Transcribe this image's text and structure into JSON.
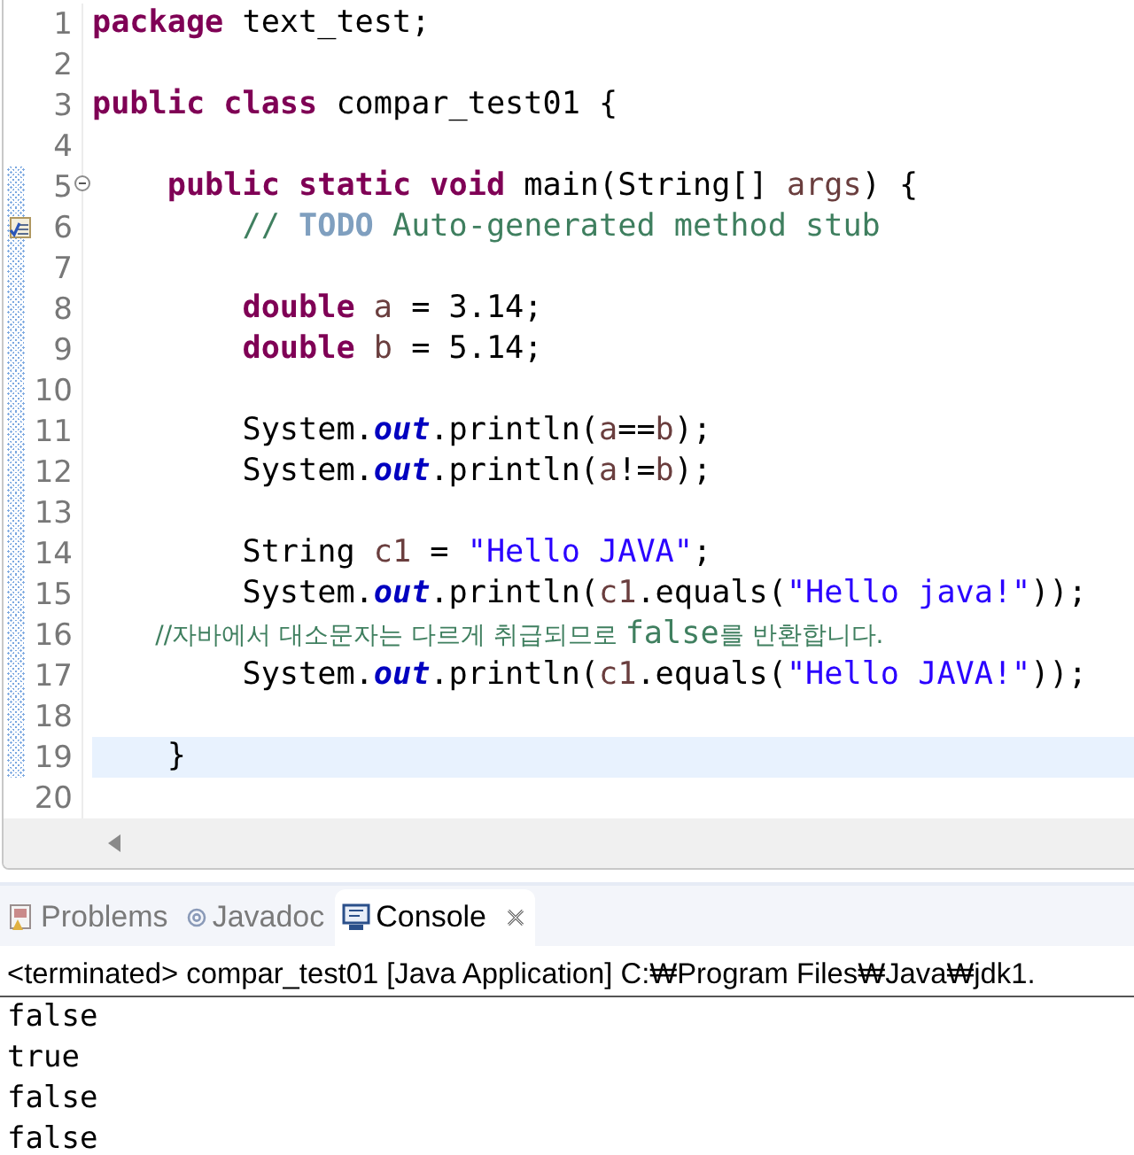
{
  "editor": {
    "lines": [
      {
        "number": "1",
        "kind": "code",
        "range": false,
        "current": false,
        "tokens": [
          {
            "kind": "keyword",
            "text": "package"
          },
          {
            "kind": "plain",
            "text": " text_test;"
          }
        ]
      },
      {
        "number": "2",
        "kind": "code",
        "range": false,
        "current": false
      },
      {
        "number": "3",
        "kind": "code",
        "range": false,
        "current": false,
        "tokens": [
          {
            "kind": "keyword",
            "text": "public"
          },
          {
            "kind": "keyword",
            "text": " class"
          },
          {
            "kind": "plain",
            "text": " compar_test01 {"
          }
        ]
      },
      {
        "number": "4",
        "kind": "code",
        "range": false,
        "current": false
      },
      {
        "number": "5",
        "kind": "fold",
        "range": true,
        "current": false,
        "tokens": [
          {
            "kind": "keyword",
            "text": "    public"
          },
          {
            "kind": "keyword",
            "text": " static"
          },
          {
            "kind": "keyword",
            "text": " void"
          },
          {
            "kind": "plain",
            "text": " main(String[] "
          },
          {
            "kind": "local",
            "text": "args"
          },
          {
            "kind": "plain",
            "text": ") {"
          }
        ]
      },
      {
        "number": "6",
        "kind": "task",
        "range": true,
        "current": false,
        "tokens": [
          {
            "kind": "comment",
            "text": "        // "
          },
          {
            "kind": "todo",
            "text": "TODO"
          },
          {
            "kind": "comment",
            "text": " Auto-generated method stub"
          }
        ]
      },
      {
        "number": "7",
        "kind": "code",
        "range": true,
        "current": false
      },
      {
        "number": "8",
        "kind": "code",
        "range": true,
        "current": false,
        "tokens": [
          {
            "kind": "keyword",
            "text": "        double"
          },
          {
            "kind": "local",
            "text": " a"
          },
          {
            "kind": "plain",
            "text": " = 3.14;"
          }
        ]
      },
      {
        "number": "9",
        "kind": "code",
        "range": true,
        "current": false,
        "tokens": [
          {
            "kind": "keyword",
            "text": "        double"
          },
          {
            "kind": "local",
            "text": " b"
          },
          {
            "kind": "plain",
            "text": " = 5.14;"
          }
        ]
      },
      {
        "number": "10",
        "kind": "code",
        "range": true,
        "current": false
      },
      {
        "number": "11",
        "kind": "code",
        "range": true,
        "current": false,
        "tokens": [
          {
            "kind": "plain",
            "text": "        System."
          },
          {
            "kind": "field",
            "text": "out"
          },
          {
            "kind": "plain",
            "text": ".println("
          },
          {
            "kind": "local",
            "text": "a"
          },
          {
            "kind": "plain",
            "text": "=="
          },
          {
            "kind": "local",
            "text": "b"
          },
          {
            "kind": "plain",
            "text": ");"
          }
        ]
      },
      {
        "number": "12",
        "kind": "code",
        "range": true,
        "current": false,
        "tokens": [
          {
            "kind": "plain",
            "text": "        System."
          },
          {
            "kind": "field",
            "text": "out"
          },
          {
            "kind": "plain",
            "text": ".println("
          },
          {
            "kind": "local",
            "text": "a"
          },
          {
            "kind": "plain",
            "text": "!="
          },
          {
            "kind": "local",
            "text": "b"
          },
          {
            "kind": "plain",
            "text": ");"
          }
        ]
      },
      {
        "number": "13",
        "kind": "code",
        "range": true,
        "current": false
      },
      {
        "number": "14",
        "kind": "code",
        "range": true,
        "current": false,
        "tokens": [
          {
            "kind": "plain",
            "text": "        String "
          },
          {
            "kind": "local",
            "text": "c1"
          },
          {
            "kind": "plain",
            "text": " = "
          },
          {
            "kind": "string",
            "text": "\"Hello JAVA\""
          },
          {
            "kind": "plain",
            "text": ";"
          }
        ]
      },
      {
        "number": "15",
        "kind": "code",
        "range": true,
        "current": false,
        "tokens": [
          {
            "kind": "plain",
            "text": "        System."
          },
          {
            "kind": "field",
            "text": "out"
          },
          {
            "kind": "plain",
            "text": ".println("
          },
          {
            "kind": "local",
            "text": "c1"
          },
          {
            "kind": "plain",
            "text": ".equals("
          },
          {
            "kind": "string",
            "text": "\"Hello java!\""
          },
          {
            "kind": "plain",
            "text": "));"
          }
        ]
      },
      {
        "number": "16",
        "kind": "code",
        "range": true,
        "current": false,
        "tokens": [
          {
            "kind": "comment-cjk",
            "text": "        //자바에서 대소문자는 다르게 취급되므로 "
          },
          {
            "kind": "comment",
            "text": "false"
          },
          {
            "kind": "comment-cjk",
            "text": "를 반환합니다."
          }
        ]
      },
      {
        "number": "17",
        "kind": "code",
        "range": true,
        "current": false,
        "tokens": [
          {
            "kind": "plain",
            "text": "        System."
          },
          {
            "kind": "field",
            "text": "out"
          },
          {
            "kind": "plain",
            "text": ".println("
          },
          {
            "kind": "local",
            "text": "c1"
          },
          {
            "kind": "plain",
            "text": ".equals("
          },
          {
            "kind": "string",
            "text": "\"Hello JAVA!\""
          },
          {
            "kind": "plain",
            "text": "));"
          }
        ]
      },
      {
        "number": "18",
        "kind": "code",
        "range": true,
        "current": false
      },
      {
        "number": "19",
        "kind": "code",
        "range": true,
        "current": true,
        "tokens": [
          {
            "kind": "plain",
            "text": "    }"
          }
        ]
      },
      {
        "number": "20",
        "kind": "code",
        "range": false,
        "current": false
      }
    ]
  },
  "tabs": [
    {
      "label": "Problems",
      "selected": false
    },
    {
      "label": "Javadoc",
      "selected": false
    },
    {
      "label": "Console",
      "selected": true
    }
  ],
  "console": {
    "header": "<terminated> compar_test01 [Java Application] C:₩Program Files₩Java₩jdk1.",
    "output": [
      "false",
      "true",
      "false",
      "false"
    ]
  }
}
